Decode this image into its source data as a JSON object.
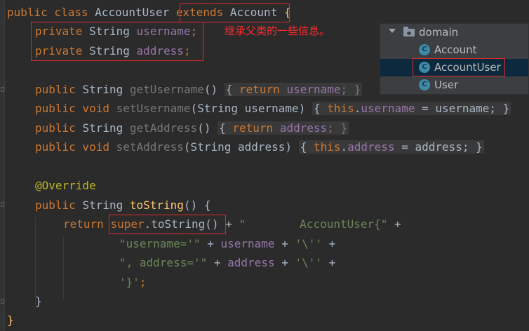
{
  "annotation": {
    "note": "继承父类的一些信息。"
  },
  "tree": {
    "package": "domain",
    "items": [
      {
        "icon": "C",
        "label": "Account"
      },
      {
        "icon": "C",
        "label": "AccountUser"
      },
      {
        "icon": "C",
        "label": "User"
      }
    ]
  },
  "code": {
    "l1": {
      "a": "public class ",
      "b": "AccountUser ",
      "c": "extends ",
      "d": "Account ",
      "e": "{"
    },
    "l2": {
      "a": "private ",
      "b": "String ",
      "c": "username",
      "d": ";"
    },
    "l3": {
      "a": "private ",
      "b": "String ",
      "c": "address",
      "d": ";"
    },
    "l4": {
      "a": "public ",
      "b": "String ",
      "c": "getUsername",
      "d": "() ",
      "e": "{ ",
      "f": "return ",
      "g": "username",
      "h": "; }"
    },
    "l5": {
      "a": "public void ",
      "b": "setUsername",
      "c": "(String username) ",
      "d": "{ ",
      "e": "this",
      "f": ".",
      "g": "username",
      "h": " = username; }"
    },
    "l6": {
      "a": "public ",
      "b": "String ",
      "c": "getAddress",
      "d": "() ",
      "e": "{ ",
      "f": "return ",
      "g": "address",
      "h": "; }"
    },
    "l7": {
      "a": "public void ",
      "b": "setAddress",
      "c": "(String address) ",
      "d": "{ ",
      "e": "this",
      "f": ".",
      "g": "address",
      "h": " = address; }"
    },
    "l8": {
      "a": "@Override"
    },
    "l9": {
      "a": "public ",
      "b": "String ",
      "c": "toString",
      "d": "() {"
    },
    "l10": {
      "a": "return ",
      "b": "super",
      "c": ".toString()",
      "d": " + ",
      "e": "\"        AccountUser{\"",
      "f": " +"
    },
    "l11": {
      "a": "\"username='\"",
      "b": " + ",
      "c": "username",
      "d": " + ",
      "e": "'\\''",
      "f": " +"
    },
    "l12": {
      "a": "\", address='\"",
      "b": " + ",
      "c": "address",
      "d": " + ",
      "e": "'\\''",
      "f": " +"
    },
    "l13": {
      "a": "'}'",
      "b": ";"
    },
    "l14": {
      "a": "}"
    },
    "l15": {
      "a": "}"
    }
  }
}
